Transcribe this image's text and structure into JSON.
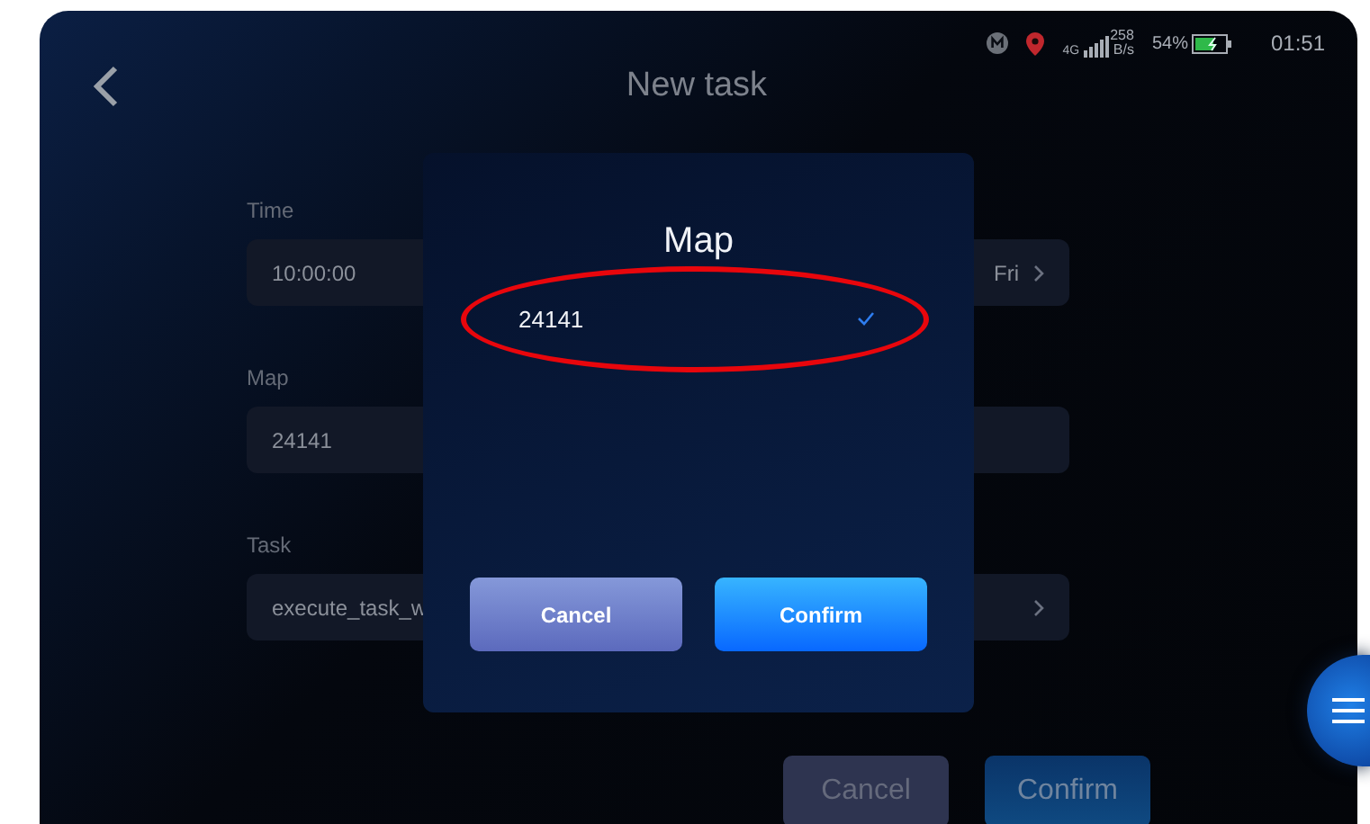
{
  "status_bar": {
    "network": "4G",
    "speed_value": "258",
    "speed_unit": "B/s",
    "battery_percent": "54%",
    "time": "01:51"
  },
  "header": {
    "title": "New task"
  },
  "form": {
    "fields": [
      {
        "label": "Time",
        "value": "10:00:00",
        "trailing": "Fri",
        "chevron": true
      },
      {
        "label": "Map",
        "value": "24141",
        "chevron": false
      },
      {
        "label": "Task",
        "value": "execute_task_w",
        "chevron": true
      }
    ]
  },
  "footer_buttons": [
    {
      "label": "Cancel",
      "kind": "secondary"
    },
    {
      "label": "Confirm",
      "kind": "primary"
    }
  ],
  "dialog": {
    "title": "Map",
    "options": [
      {
        "label": "24141",
        "selected": true,
        "circled": true
      }
    ],
    "buttons": [
      {
        "label": "Cancel",
        "kind": "secondary"
      },
      {
        "label": "Confirm",
        "kind": "primary"
      }
    ]
  }
}
